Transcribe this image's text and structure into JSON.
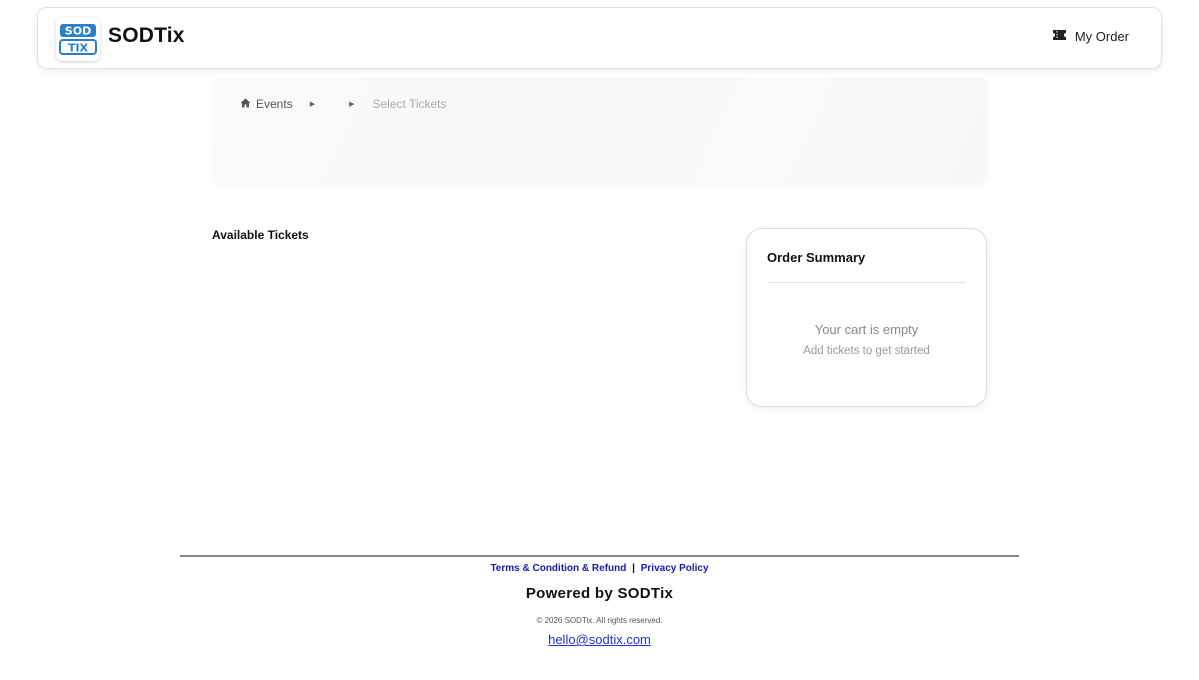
{
  "header": {
    "brand": "SODTix",
    "logo_text_top": "SOD",
    "logo_text_bottom": "TIX",
    "my_order_label": "My Order"
  },
  "breadcrumb": {
    "home_label": "Events",
    "middle_label": "",
    "current_label": "Select Tickets"
  },
  "main": {
    "available_title": "Available Tickets"
  },
  "order_summary": {
    "title": "Order Summary",
    "empty_title": "Your cart is empty",
    "empty_subtitle": "Add tickets to get started"
  },
  "footer": {
    "terms_label": "Terms & Condition & Refund",
    "separator": "|",
    "privacy_label": "Privacy Policy",
    "powered_by": "Powered by SODTix",
    "copyright": "© 2026 SODTix. All rights reserved.",
    "email": "hello@sodtix.com"
  },
  "colors": {
    "logo_blue": "#2a7fc9",
    "link_blue": "#1a1aa6"
  }
}
